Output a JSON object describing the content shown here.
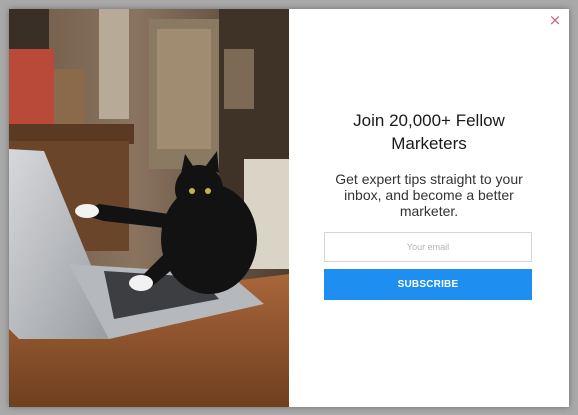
{
  "popup": {
    "close_glyph": "×",
    "headline": "Join 20,000+ Fellow Marketers",
    "subtext": "Get expert tips straight to your inbox, and become a better marketer.",
    "email_placeholder": "Your email",
    "email_value": "",
    "subscribe_label": "SUBSCRIBE"
  },
  "colors": {
    "accent": "#1e8ef0",
    "close": "#c9637a",
    "overlay": "#a9a9a9"
  }
}
